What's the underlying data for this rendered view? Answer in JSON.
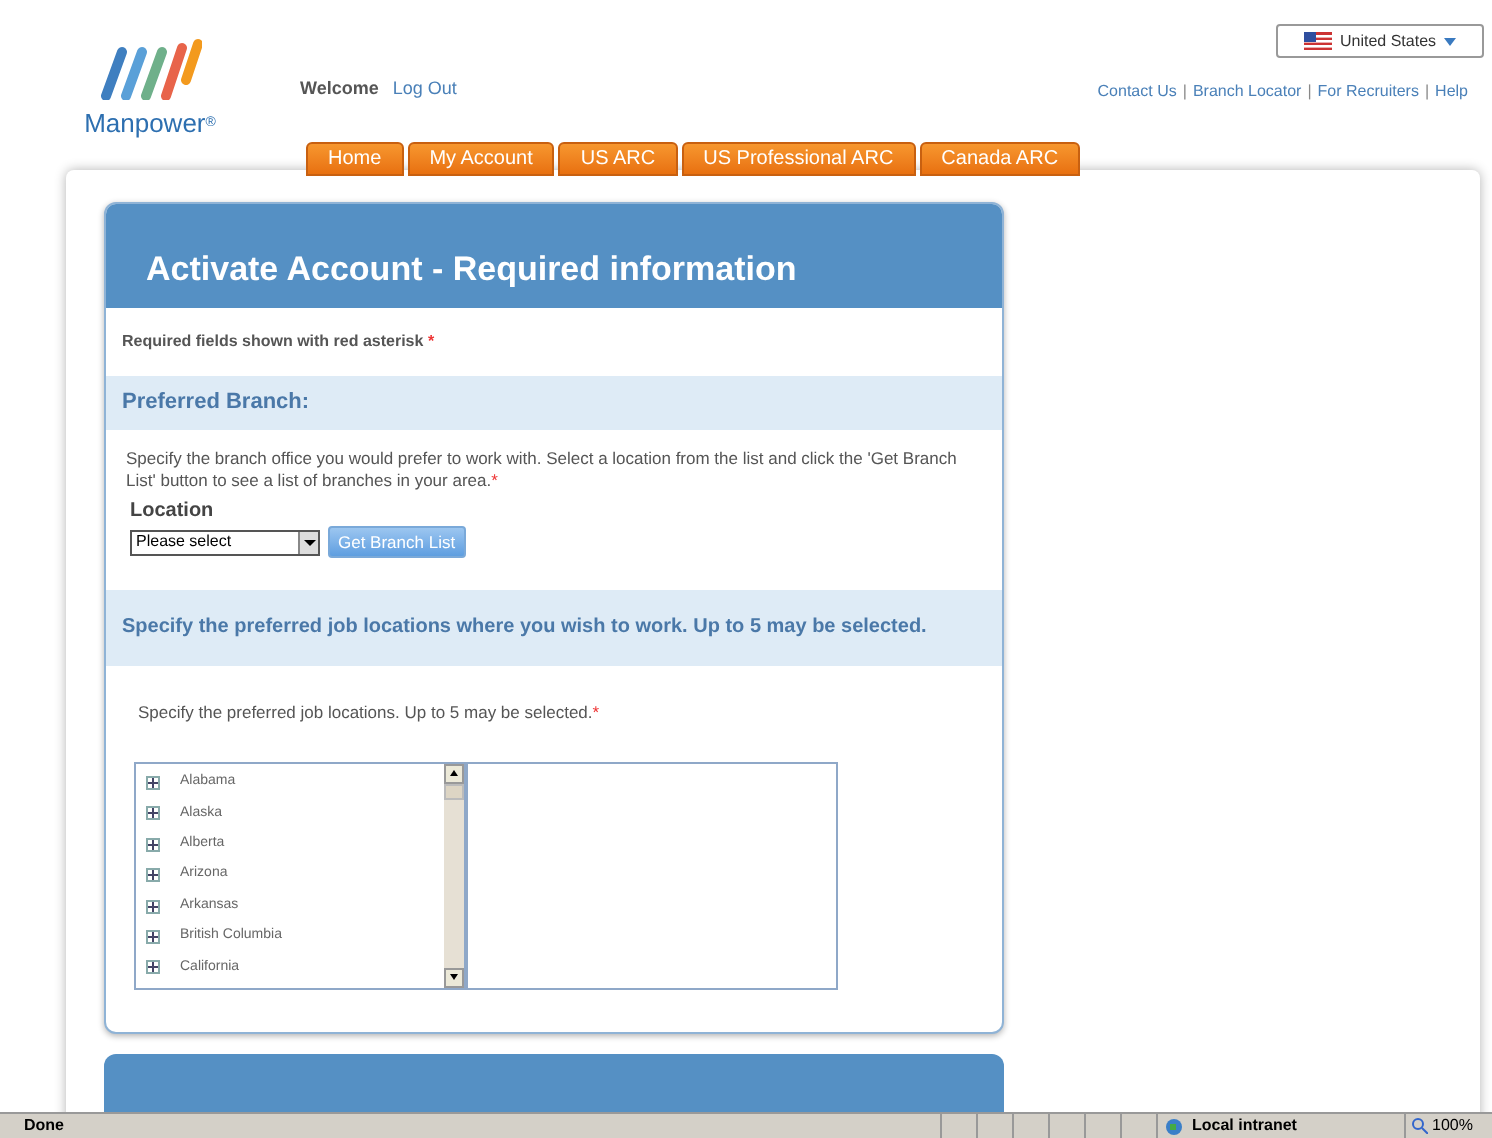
{
  "header": {
    "logo_text": "Manpower",
    "logo_mark": "®",
    "country": "United States",
    "welcome": "Welcome",
    "logout": "Log Out",
    "links": [
      "Contact Us",
      "Branch Locator",
      "For Recruiters",
      "Help"
    ],
    "separator": "|"
  },
  "tabs": [
    {
      "label": "Home",
      "selected": false
    },
    {
      "label": "My Account",
      "selected": false
    },
    {
      "label": "US ARC",
      "selected": false
    },
    {
      "label": "US Professional ARC",
      "selected": false
    },
    {
      "label": "Canada ARC",
      "selected": false
    }
  ],
  "form": {
    "title": "Activate Account - Required information",
    "required_note": "Required fields shown with red asterisk",
    "asterisk": "*",
    "branch": {
      "heading": "Preferred Branch:",
      "text": "Specify the branch office you would prefer to work with. Select a location from the list and click the 'Get Branch List' button to see a list of branches in your area.",
      "location_label": "Location",
      "select_value": "Please select",
      "button": "Get Branch List"
    },
    "jobs": {
      "heading": "Specify the preferred job locations where you wish to work. Up to 5 may be selected.",
      "text": "Specify the preferred job locations. Up to 5 may be selected.",
      "tree": [
        {
          "label": "Alabama",
          "expanded": false
        },
        {
          "label": "Alaska",
          "expanded": false
        },
        {
          "label": "Alberta",
          "expanded": false
        },
        {
          "label": "Arizona",
          "expanded": false
        },
        {
          "label": "Arkansas",
          "expanded": false
        },
        {
          "label": "British Columbia",
          "expanded": false
        },
        {
          "label": "California",
          "expanded": false
        }
      ]
    }
  },
  "status_bar": {
    "text": "Done",
    "zone": "Local intranet",
    "zoom": "100%"
  }
}
